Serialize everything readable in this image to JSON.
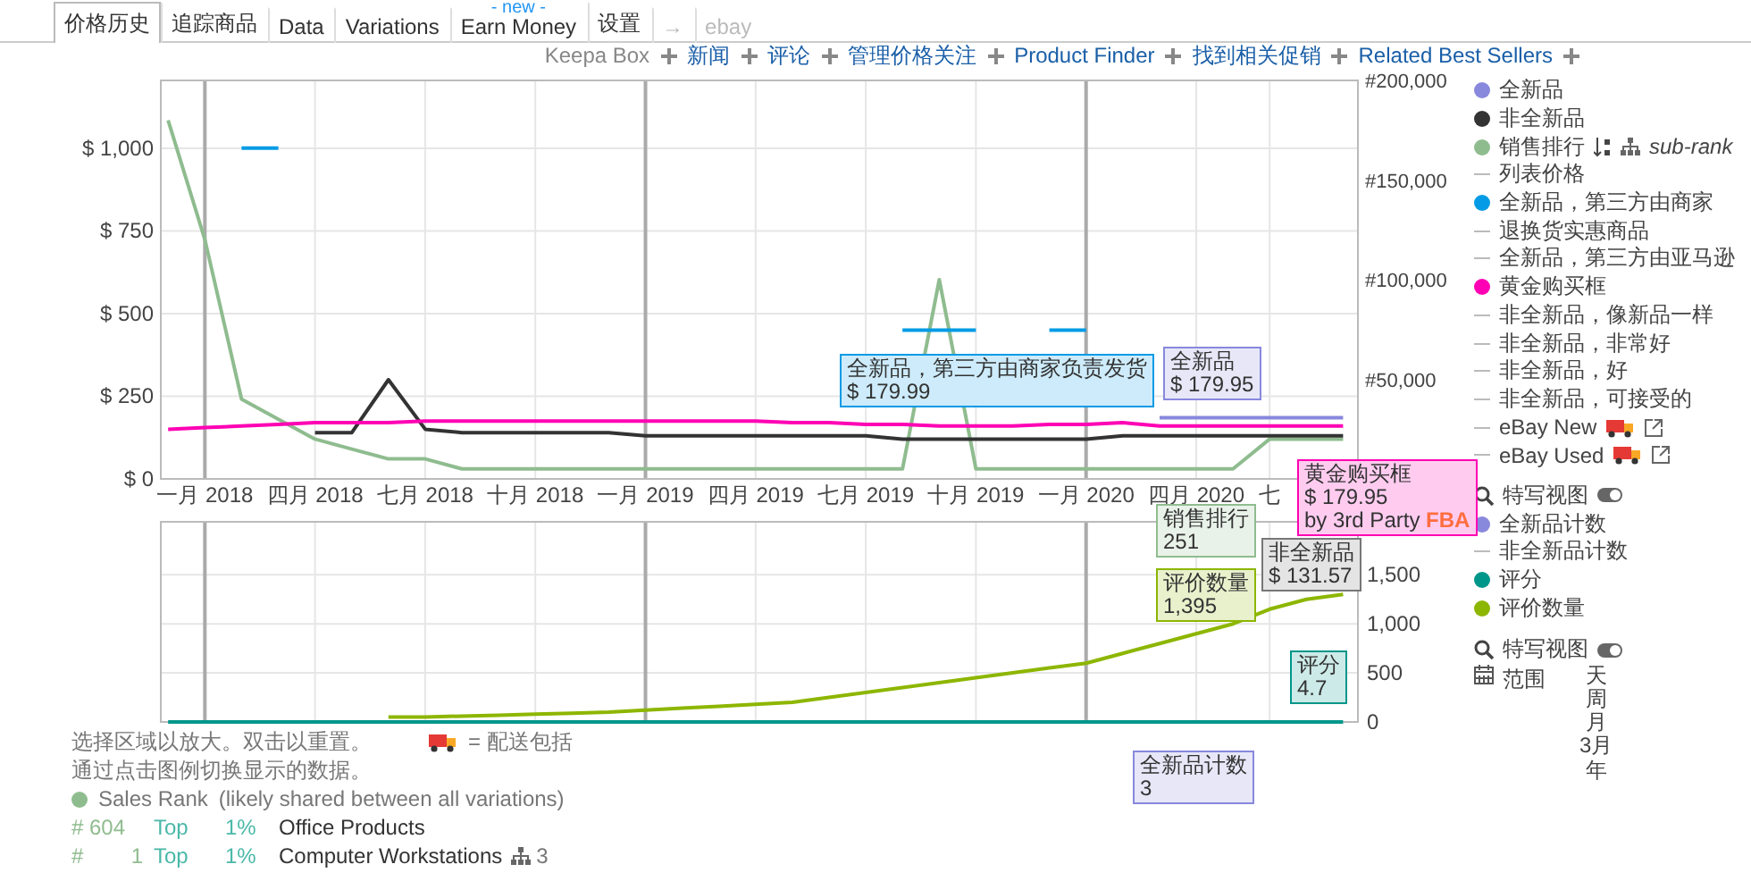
{
  "tabs": [
    {
      "label": "价格历史",
      "selected": true,
      "disabled": false
    },
    {
      "label": "追踪商品",
      "selected": false,
      "disabled": false
    },
    {
      "label": "Data",
      "selected": false,
      "disabled": false
    },
    {
      "label": "Variations",
      "selected": false,
      "disabled": false
    },
    {
      "label": "Earn Money",
      "selected": false,
      "disabled": false,
      "badge": "- new -"
    },
    {
      "label": "设置",
      "selected": false,
      "disabled": false
    },
    {
      "label": "→",
      "selected": false,
      "disabled": true
    },
    {
      "label": "ebay",
      "selected": false,
      "disabled": true
    }
  ],
  "links": [
    {
      "label": "Keepa Box",
      "disabled": true
    },
    {
      "label": "新闻",
      "disabled": false
    },
    {
      "label": "评论",
      "disabled": false
    },
    {
      "label": "管理价格关注",
      "disabled": false
    },
    {
      "label": "Product Finder",
      "disabled": false
    },
    {
      "label": "找到相关促销",
      "disabled": false
    },
    {
      "label": "Related Best Sellers",
      "disabled": false
    }
  ],
  "price_chart": {
    "chart_data": {
      "type": "line",
      "categories": [
        null,
        "一月 2018",
        null,
        null,
        "四月 2018",
        null,
        null,
        "七月 2018",
        null,
        null,
        "十月 2018",
        null,
        null,
        "一月 2019",
        null,
        null,
        "四月 2019",
        null,
        null,
        "七月 2019",
        null,
        null,
        "十月 2019",
        null,
        null,
        "一月 2020",
        null,
        null,
        "四月 2020",
        null,
        "七",
        null,
        null
      ],
      "ylim": [
        0,
        1205
      ],
      "y2lim": [
        0,
        200000
      ],
      "yticks": [
        {
          "value": 0,
          "label": "$ 0"
        },
        {
          "value": 250,
          "label": "$ 250"
        },
        {
          "value": 500,
          "label": "$ 500"
        },
        {
          "value": 750,
          "label": "$ 750"
        },
        {
          "value": 1000,
          "label": "$ 1,000"
        }
      ],
      "y2ticks": [
        {
          "value": 200000,
          "label": "#200,000"
        },
        {
          "value": 150000,
          "label": "#150,000"
        },
        {
          "value": 100000,
          "label": "#100,000"
        },
        {
          "value": 50000,
          "label": "#50,000"
        }
      ],
      "series": [
        {
          "color": "#8fbc8f",
          "axis": "y2",
          "values": [
            180000,
            120000,
            40000,
            30000,
            20000,
            15000,
            10000,
            10000,
            5000,
            5000,
            5000,
            5000,
            5000,
            5000,
            5000,
            5000,
            5000,
            5000,
            5000,
            5000,
            5000,
            100000,
            5000,
            5000,
            5000,
            5000,
            5000,
            5000,
            5000,
            5000,
            20000,
            20000,
            20000
          ]
        },
        {
          "color": "#333333",
          "values": [
            null,
            null,
            null,
            null,
            140,
            140,
            300,
            150,
            140,
            140,
            140,
            140,
            140,
            130,
            130,
            130,
            130,
            130,
            130,
            130,
            120,
            120,
            120,
            120,
            120,
            120,
            130,
            130,
            130,
            130,
            130,
            130,
            130
          ]
        },
        {
          "color": "#039be5",
          "values": [
            null,
            null,
            1000,
            1000,
            null,
            null,
            null,
            null,
            null,
            null,
            null,
            null,
            null,
            null,
            null,
            null,
            null,
            null,
            null,
            null,
            450,
            450,
            450,
            null,
            450,
            450,
            null,
            null,
            null,
            null,
            null,
            null,
            null
          ]
        },
        {
          "color": "#ff00b4",
          "values": [
            150,
            155,
            160,
            165,
            170,
            170,
            170,
            175,
            175,
            175,
            175,
            175,
            175,
            175,
            175,
            175,
            175,
            170,
            170,
            165,
            165,
            160,
            160,
            160,
            165,
            165,
            170,
            160,
            160,
            160,
            160,
            160,
            160
          ]
        },
        {
          "color": "#8888dd",
          "values": [
            null,
            null,
            null,
            null,
            null,
            null,
            null,
            null,
            null,
            null,
            null,
            null,
            null,
            null,
            null,
            null,
            null,
            null,
            null,
            null,
            null,
            null,
            null,
            null,
            null,
            null,
            null,
            185,
            185,
            185,
            185,
            185,
            185
          ]
        }
      ],
      "grid": true
    }
  },
  "count_chart": {
    "chart_data": {
      "type": "line",
      "categories": [
        null,
        null,
        null,
        null,
        null,
        null,
        null,
        null,
        null,
        null,
        null,
        null,
        null,
        null,
        null,
        null,
        null,
        null,
        null,
        null,
        null,
        null,
        null,
        null,
        null,
        null,
        null,
        null,
        null,
        null,
        null,
        null,
        null
      ],
      "ylim": [
        0,
        2040
      ],
      "yticks": [
        {
          "value": 0,
          "label": "0"
        },
        {
          "value": 500,
          "label": "500"
        },
        {
          "value": 1000,
          "label": "1,000"
        },
        {
          "value": 1500,
          "label": "1,500"
        }
      ],
      "series": [
        {
          "color": "#8db600",
          "values": [
            null,
            null,
            null,
            null,
            null,
            null,
            50,
            50,
            60,
            70,
            80,
            90,
            100,
            120,
            140,
            160,
            180,
            200,
            250,
            300,
            350,
            400,
            450,
            500,
            550,
            600,
            700,
            800,
            900,
            1000,
            1150,
            1250,
            1300
          ]
        },
        {
          "color": "#00968a",
          "values": [
            0,
            0,
            0,
            0,
            0,
            0,
            0,
            0,
            0,
            0,
            0,
            0,
            0,
            0,
            0,
            0,
            0,
            0,
            0,
            0,
            0,
            0,
            0,
            0,
            0,
            0,
            0,
            0,
            0,
            0,
            0,
            0,
            0
          ]
        }
      ],
      "grid": true
    }
  },
  "tooltips": [
    {
      "title": "全新品，第三方由商家负责发货",
      "value": "$ 179.99",
      "color": "#039be5"
    },
    {
      "title": "全新品",
      "value": "$ 179.95",
      "color": "#8888dd"
    },
    {
      "title": "黄金购买框",
      "value": "$ 179.95",
      "note": "by 3rd Party",
      "tag": "FBA",
      "color": "#ff00b4"
    },
    {
      "title": "销售排行",
      "value": "251",
      "color": "#8fbc8f"
    },
    {
      "title": "非全新品",
      "value": "$ 131.57",
      "color": "#777777"
    },
    {
      "title": "评价数量",
      "value": "1,395",
      "color": "#8db600"
    },
    {
      "title": "评分",
      "value": "4.7",
      "color": "#00968a"
    },
    {
      "title": "全新品计数",
      "value": "3",
      "color": "#8888dd"
    }
  ],
  "legend": [
    {
      "kind": "dot",
      "label": "全新品",
      "color": "#8888dd"
    },
    {
      "kind": "dot",
      "label": "非全新品",
      "color": "#333333"
    },
    {
      "kind": "rank",
      "label": "销售排行",
      "color": "#8fbc8f",
      "extra": "sub-rank"
    },
    {
      "kind": "dash",
      "label": "列表价格"
    },
    {
      "kind": "dot",
      "label": "全新品，第三方由商家",
      "color": "#039be5"
    },
    {
      "kind": "dash",
      "label": "退换货实惠商品"
    },
    {
      "kind": "dash",
      "label": "全新品，第三方由亚马逊"
    },
    {
      "kind": "dot",
      "label": "黄金购买框",
      "color": "#ff00b4"
    },
    {
      "kind": "dash",
      "label": "非全新品，像新品一样"
    },
    {
      "kind": "dash",
      "label": "非全新品，非常好"
    },
    {
      "kind": "dash",
      "label": "非全新品，好"
    },
    {
      "kind": "dash",
      "label": "非全新品，可接受的"
    },
    {
      "kind": "ebay",
      "label": "eBay New"
    },
    {
      "kind": "ebay",
      "label": "eBay Used"
    }
  ],
  "closeup_top": {
    "label": "特写视图",
    "on": true
  },
  "legend_lower": [
    {
      "kind": "dot",
      "label": "全新品计数",
      "color": "#8888dd"
    },
    {
      "kind": "dash",
      "label": "非全新品计数"
    },
    {
      "kind": "dot",
      "label": "评分",
      "color": "#00968a"
    },
    {
      "kind": "dot",
      "label": "评价数量",
      "color": "#8db600"
    }
  ],
  "closeup_bottom": {
    "label": "特写视图",
    "on": true
  },
  "range": {
    "label": "范围",
    "options": [
      "天",
      "周",
      "月",
      "3月",
      "年"
    ]
  },
  "hints": [
    "选择区域以放大。双击以重置。",
    "= 配送包括",
    "通过点击图例切换显示的数据。"
  ],
  "sales_rank": {
    "title": "Sales Rank",
    "note": "(likely shared between all variations)",
    "rows": [
      {
        "hash": "#",
        "rank": "604",
        "top": "Top",
        "percent": "1%",
        "category": "Office Products"
      },
      {
        "hash": "#",
        "rank": "1",
        "top": "Top",
        "percent": "1%",
        "category": "Computer Workstations",
        "subcount": "3"
      }
    ]
  }
}
